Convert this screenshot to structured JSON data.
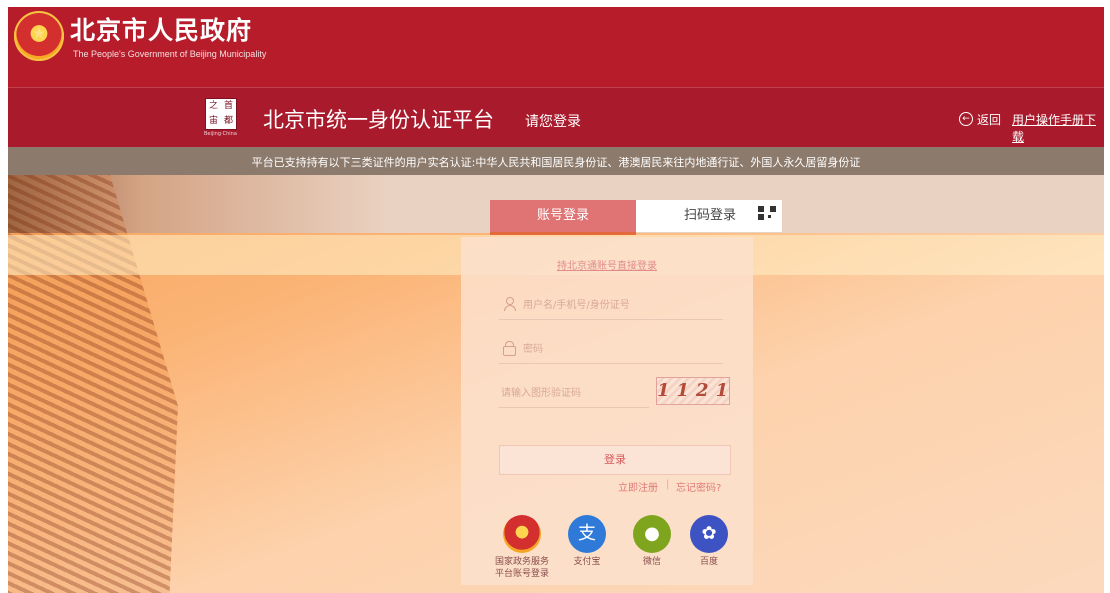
{
  "header": {
    "title": "北京市人民政府",
    "subtitle": "The People's Government of Beijing Municipality"
  },
  "subheader": {
    "seal_chars": [
      "之",
      "首",
      "宙",
      "都"
    ],
    "seal_caption": "Beijing·China",
    "platform_title": "北京市统一身份认证平台",
    "login_prompt": "请您登录",
    "back_label": "返回",
    "manual_link": "用户操作手册下载"
  },
  "notice": "平台已支持持有以下三类证件的用户实名认证:中华人民共和国居民身份证、港澳居民来往内地通行证、外国人永久居留身份证",
  "login": {
    "tabs": [
      {
        "label": "账号登录",
        "active": true
      },
      {
        "label": "扫码登录",
        "active": false
      }
    ],
    "hint": "持北京通账号直接登录",
    "username_placeholder": "用户名/手机号/身份证号",
    "password_placeholder": "密码",
    "captcha_placeholder": "请输入图形验证码",
    "captcha_text": "1121",
    "login_button": "登录",
    "register_link": "立即注册",
    "separator": "|",
    "forgot_link": "忘记密码?"
  },
  "social_logins": [
    {
      "label": "国家政务服务平台账号登录",
      "icon": "national-emblem-icon",
      "color": "#d32f2f"
    },
    {
      "label": "支付宝",
      "icon": "alipay-icon",
      "color": "#2f7ad8"
    },
    {
      "label": "微信",
      "icon": "wechat-icon",
      "color": "#7fa51e"
    },
    {
      "label": "百度",
      "icon": "baidu-icon",
      "color": "#3d52c3"
    }
  ]
}
